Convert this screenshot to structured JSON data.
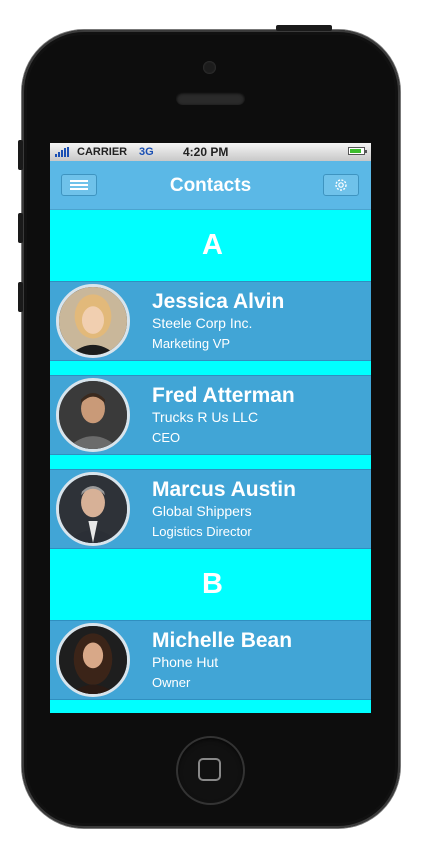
{
  "status_bar": {
    "carrier": "CARRIER",
    "network": "3G",
    "time": "4:20 PM",
    "battery_level": 0.85
  },
  "nav": {
    "title": "Contacts",
    "menu_icon": "hamburger-menu-icon",
    "settings_icon": "gear-icon"
  },
  "sections": [
    {
      "letter": "A",
      "contacts": [
        {
          "name": "Jessica Alvin",
          "company": "Steele Corp Inc.",
          "title": "Marketing VP"
        },
        {
          "name": "Fred Atterman",
          "company": "Trucks R Us LLC",
          "title": "CEO"
        },
        {
          "name": "Marcus Austin",
          "company": "Global Shippers",
          "title": "Logistics Director"
        }
      ]
    },
    {
      "letter": "B",
      "contacts": [
        {
          "name": "Michelle Bean",
          "company": "Phone Hut",
          "title": "Owner"
        }
      ]
    }
  ],
  "colors": {
    "navbar": "#5bb8e6",
    "row": "#41a5d6",
    "section_bg": "#00ffff"
  }
}
